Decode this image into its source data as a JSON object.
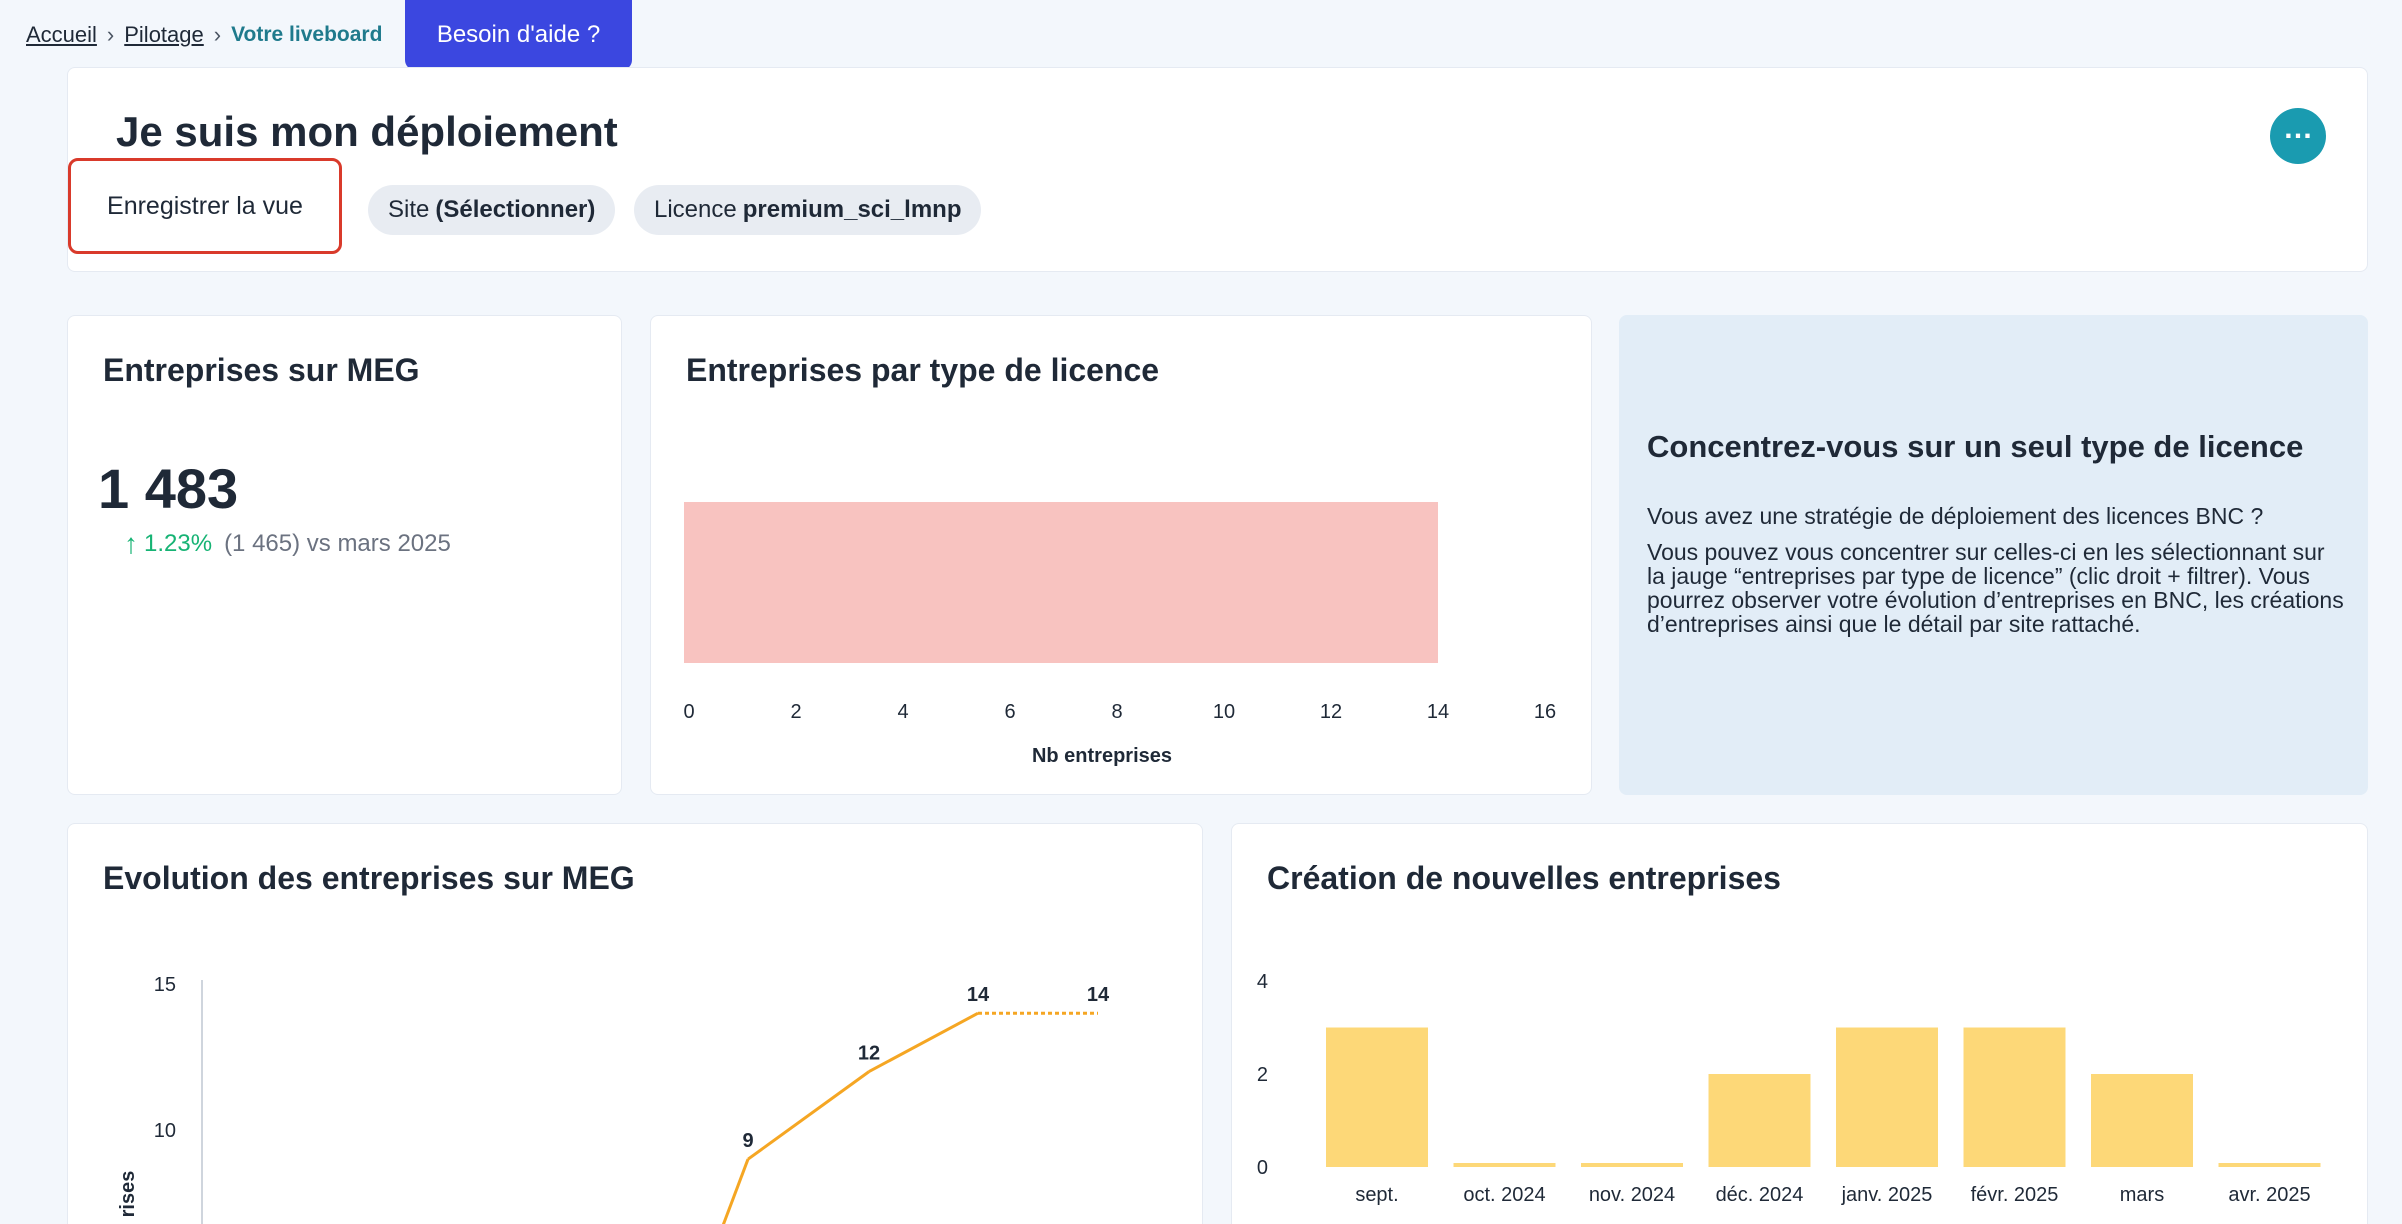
{
  "breadcrumb": {
    "items": [
      "Accueil",
      "Pilotage"
    ],
    "current": "Votre liveboard"
  },
  "help_button": "Besoin d'aide ?",
  "header": {
    "title": "Je suis mon déploiement",
    "save_view": "Enregistrer la vue",
    "filters": [
      {
        "label": "Site",
        "value": "(Sélectionner)"
      },
      {
        "label": "Licence",
        "value": "premium_sci_lmnp"
      }
    ],
    "more_icon": "ellipsis-icon"
  },
  "kpi": {
    "title": "Entreprises sur MEG",
    "value": "1 483",
    "delta_pct": "1.23%",
    "comparison": "(1 465) vs mars 2025",
    "trend_icon": "arrow-up-icon",
    "trend_color": "#16b374"
  },
  "licence_chart": {
    "title": "Entreprises par type de licence",
    "chart_data": {
      "type": "bar",
      "orientation": "horizontal",
      "categories": [
        ""
      ],
      "values": [
        14
      ],
      "xlabel": "Nb entreprises",
      "xlim": [
        0,
        16
      ],
      "xticks": [
        "0",
        "2",
        "4",
        "6",
        "8",
        "10",
        "12",
        "14",
        "16"
      ],
      "color": "#f8c3c0"
    }
  },
  "info": {
    "title": "Concentrez-vous sur un seul type de licence",
    "p1": "Vous avez une stratégie de déploiement des licences BNC ?",
    "p2": "Vous pouvez vous concentrer sur celles-ci en les sélectionnant sur la jauge “entreprises par type de licence” (clic droit + filtrer). Vous pourrez observer votre évolution d’entreprises en BNC, les créations d’entreprises ainsi que le détail par site rattaché."
  },
  "evolution_chart": {
    "title": "Evolution des entreprises sur MEG",
    "chart_data": {
      "type": "line",
      "ylabel": "rises",
      "yticks": [
        "15",
        "10"
      ],
      "ylim_visible": [
        7,
        15
      ],
      "points": [
        {
          "label": "",
          "value": 9
        },
        {
          "label": "12",
          "value": 12
        },
        {
          "label": "14",
          "value": 14
        },
        {
          "label": "14",
          "value": 14,
          "projected": true
        }
      ],
      "color": "#f5a623"
    }
  },
  "creation_chart": {
    "title": "Création de nouvelles entreprises",
    "chart_data": {
      "type": "bar",
      "categories": [
        "sept.",
        "oct. 2024",
        "nov. 2024",
        "déc. 2024",
        "janv. 2025",
        "févr. 2025",
        "mars",
        "avr. 2025"
      ],
      "values": [
        3,
        0,
        0,
        2,
        3,
        3,
        2,
        0
      ],
      "yticks": [
        "4",
        "2",
        "0"
      ],
      "ylim": [
        0,
        4
      ],
      "color": "#fdd878"
    }
  }
}
